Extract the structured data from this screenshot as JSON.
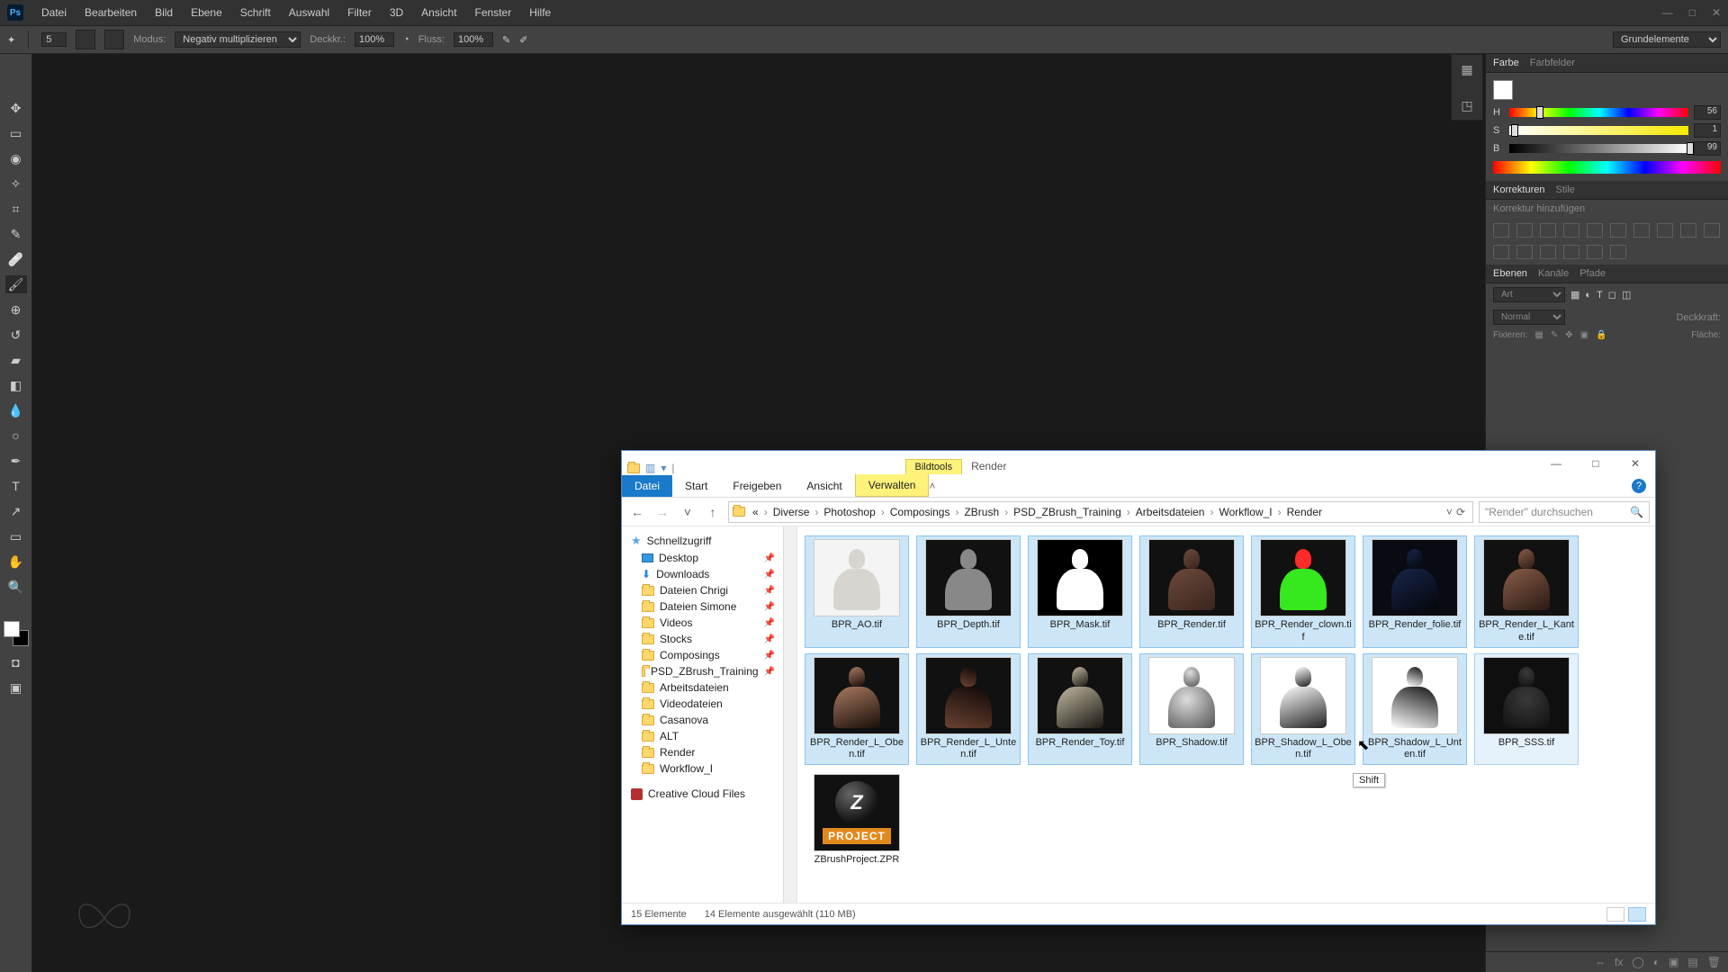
{
  "ps": {
    "logo": "Ps",
    "menu": [
      "Datei",
      "Bearbeiten",
      "Bild",
      "Ebene",
      "Schrift",
      "Auswahl",
      "Filter",
      "3D",
      "Ansicht",
      "Fenster",
      "Hilfe"
    ],
    "options": {
      "size_value": "5",
      "mode_label": "Modus:",
      "mode_value": "Negativ multiplizieren",
      "opacity_label": "Deckkr.:",
      "opacity_value": "100%",
      "flow_label": "Fluss:",
      "flow_value": "100%",
      "farright": "Grundelemente"
    },
    "panels": {
      "color_tab_active": "Farbe",
      "color_tab_2": "Farbfelder",
      "hsb": {
        "h_label": "H",
        "s_label": "S",
        "b_label": "B",
        "h": "56",
        "s": "1",
        "b": "99"
      },
      "adjust_tab": "Korrekturen",
      "adjust_tab2": "Stile",
      "adjust_hint": "Korrektur hinzufügen",
      "layers_tab": "Ebenen",
      "layers_tab2": "Kanäle",
      "layers_tab3": "Pfade",
      "layers_search_placeholder": "Art",
      "blend_mode": "Normal",
      "opacity_label": "Deckkraft:",
      "lock_label": "Fixieren:",
      "fill_label": "Fläche:"
    }
  },
  "explorer": {
    "title_context": "Bildtools",
    "title": "Render",
    "ribbon_tabs": {
      "file": "Datei",
      "start": "Start",
      "share": "Freigeben",
      "view": "Ansicht",
      "manage": "Verwalten"
    },
    "breadcrumb": [
      "«",
      "Diverse",
      "Photoshop",
      "Composings",
      "ZBrush",
      "PSD_ZBrush_Training",
      "Arbeitsdateien",
      "Workflow_I",
      "Render"
    ],
    "search_placeholder": "\"Render\" durchsuchen",
    "sidebar": {
      "quickaccess": "Schnellzugriff",
      "items": [
        {
          "label": "Desktop",
          "icon": "desktop",
          "pin": true
        },
        {
          "label": "Downloads",
          "icon": "download",
          "pin": true
        },
        {
          "label": "Dateien Chrigi",
          "icon": "folder",
          "pin": true
        },
        {
          "label": "Dateien Simone",
          "icon": "folder",
          "pin": true
        },
        {
          "label": "Videos",
          "icon": "folder",
          "pin": true
        },
        {
          "label": "Stocks",
          "icon": "folder",
          "pin": true
        },
        {
          "label": "Composings",
          "icon": "folder",
          "pin": true
        },
        {
          "label": "PSD_ZBrush_Training",
          "icon": "folder",
          "pin": true
        },
        {
          "label": "Arbeitsdateien",
          "icon": "folder",
          "pin": false
        },
        {
          "label": "Videodateien",
          "icon": "folder",
          "pin": false
        },
        {
          "label": "Casanova",
          "icon": "folder",
          "pin": false
        },
        {
          "label": "ALT",
          "icon": "folder",
          "pin": false
        },
        {
          "label": "Render",
          "icon": "folder",
          "pin": false
        },
        {
          "label": "Workflow_I",
          "icon": "folder",
          "pin": false
        }
      ],
      "cc": "Creative Cloud Files"
    },
    "files": [
      {
        "name": "BPR_AO.tif",
        "thumb": "th-light",
        "selected": true
      },
      {
        "name": "BPR_Depth.tif",
        "thumb": "th-dark",
        "selected": true
      },
      {
        "name": "BPR_Mask.tif",
        "thumb": "th-mask",
        "selected": true
      },
      {
        "name": "BPR_Render.tif",
        "thumb": "th-render",
        "selected": true
      },
      {
        "name": "BPR_Render_clown.tif",
        "thumb": "th-clown",
        "selected": true
      },
      {
        "name": "BPR_Render_folie.tif",
        "thumb": "th-folie",
        "selected": true
      },
      {
        "name": "BPR_Render_L_Kante.tif",
        "thumb": "th-kante",
        "selected": true
      },
      {
        "name": "BPR_Render_L_Oben.tif",
        "thumb": "th-oben",
        "selected": true
      },
      {
        "name": "BPR_Render_L_Unten.tif",
        "thumb": "th-unten",
        "selected": true
      },
      {
        "name": "BPR_Render_Toy.tif",
        "thumb": "th-toy",
        "selected": true
      },
      {
        "name": "BPR_Shadow.tif",
        "thumb": "th-shadow",
        "selected": true
      },
      {
        "name": "BPR_Shadow_L_Oben.tif",
        "thumb": "th-sh-oben",
        "selected": true
      },
      {
        "name": "BPR_Shadow_L_Unten.tif",
        "thumb": "th-sh-unten",
        "selected": true
      },
      {
        "name": "BPR_SSS.tif",
        "thumb": "th-sss",
        "selected": true,
        "hover": true
      },
      {
        "name": "ZBrushProject.ZPR",
        "thumb": "th-zpr",
        "selected": false
      }
    ],
    "status_left": "15 Elemente",
    "status_sel": "14 Elemente ausgewählt (110 MB)",
    "shift_badge": "Shift",
    "zpr_project_label": "PROJECT",
    "zpr_z": "Z"
  }
}
